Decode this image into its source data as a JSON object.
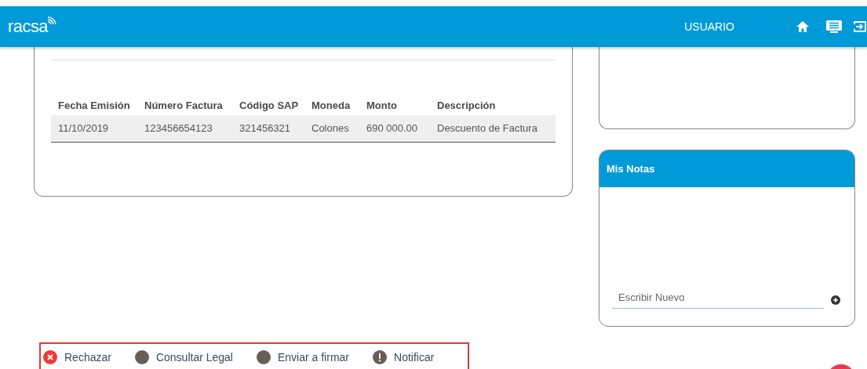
{
  "header": {
    "logo": "racsa",
    "user": "USUARIO"
  },
  "table": {
    "columns": [
      "Fecha Emisión",
      "Número Factura",
      "Código SAP",
      "Moneda",
      "Monto",
      "Descripción"
    ],
    "rows": [
      [
        "11/10/2019",
        "123456654123",
        "321456321",
        "Colones",
        "690 000.00",
        "Descuento de Factura"
      ]
    ]
  },
  "notes": {
    "title": "Mis Notas",
    "placeholder": "Escribir Nuevo"
  },
  "actions": [
    {
      "kind": "reject",
      "label": "Rechazar"
    },
    {
      "kind": "dot",
      "label": "Consultar Legal"
    },
    {
      "kind": "dot",
      "label": "Enviar a firmar"
    },
    {
      "kind": "notify",
      "label": "Notificar"
    }
  ]
}
